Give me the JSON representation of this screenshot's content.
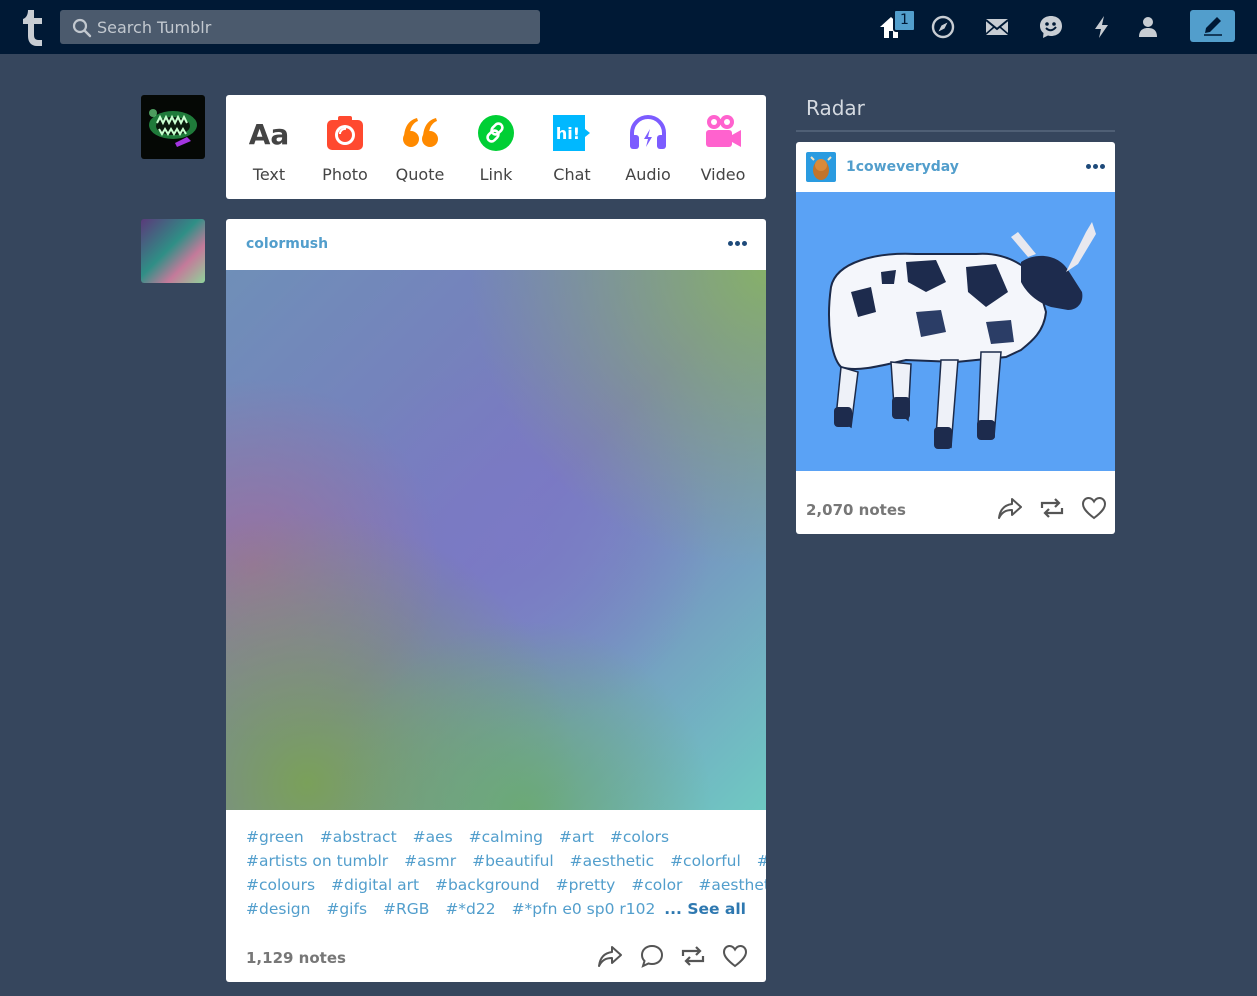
{
  "search": {
    "placeholder": "Search Tumblr"
  },
  "nav": {
    "icons": [
      "home-icon",
      "explore-icon",
      "inbox-icon",
      "messaging-icon",
      "activity-icon",
      "account-icon"
    ],
    "home_badge": "1",
    "compose_icon": "pencil-icon"
  },
  "composer": {
    "types": [
      {
        "label": "Text",
        "icon": "text-aa-icon",
        "color": "#444444"
      },
      {
        "label": "Photo",
        "icon": "camera-icon",
        "color": "#ff492f"
      },
      {
        "label": "Quote",
        "icon": "quote-icon",
        "color": "#ff8a00"
      },
      {
        "label": "Link",
        "icon": "link-icon",
        "color": "#00cf35"
      },
      {
        "label": "Chat",
        "icon": "chat-icon",
        "color": "#00b8ff"
      },
      {
        "label": "Audio",
        "icon": "headphones-icon",
        "color": "#7c5cff"
      },
      {
        "label": "Video",
        "icon": "video-camera-icon",
        "color": "#ff62ce"
      }
    ]
  },
  "post": {
    "blog_name": "colormush",
    "tags": [
      [
        "#green",
        "#abstract",
        "#aes",
        "#calming",
        "#art",
        "#colors"
      ],
      [
        "#artists on tumblr",
        "#asmr",
        "#beautiful",
        "#aesthetic",
        "#colorful",
        "#gif"
      ],
      [
        "#colours",
        "#digital art",
        "#background",
        "#pretty",
        "#color",
        "#aesthetics"
      ],
      [
        "#design",
        "#gifs",
        "#RGB",
        "#*d22",
        "#*pfn e0 sp0 r102"
      ]
    ],
    "see_all": "... See all",
    "notes": "1,129 notes"
  },
  "radar": {
    "title": "Radar",
    "blog_name": "1coweveryday",
    "notes": "2,070 notes"
  },
  "colors": {
    "topbar": "#001935",
    "background": "#36465d",
    "accent": "#529ecc"
  }
}
